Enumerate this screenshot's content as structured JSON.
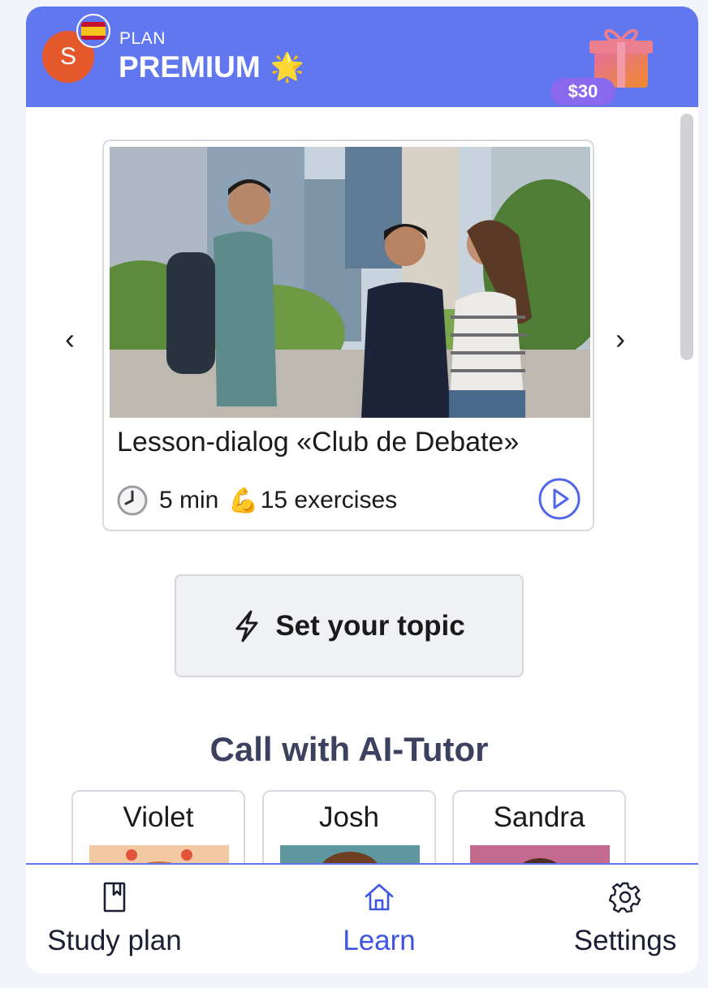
{
  "header": {
    "avatar_letter": "S",
    "plan_label": "PLAN",
    "plan_name": "PREMIUM",
    "gift_price": "$30",
    "accent_color": "#6177ef"
  },
  "lesson": {
    "title": "Lesson-dialog «Club de Debate»",
    "duration": "5 min",
    "muscle_emoji": "💪",
    "exercises": "15 exercises"
  },
  "topic_button": {
    "label": "Set your topic"
  },
  "tutors": {
    "section_title": "Call with AI-Tutor",
    "items": [
      {
        "name": "Violet"
      },
      {
        "name": "Josh"
      },
      {
        "name": "Sandra"
      }
    ]
  },
  "nav": {
    "items": [
      {
        "label": "Study plan",
        "icon": "bookmark-book-icon",
        "active": false
      },
      {
        "label": "Learn",
        "icon": "home-icon",
        "active": true
      },
      {
        "label": "Settings",
        "icon": "gear-icon",
        "active": false
      }
    ],
    "active_color": "#3d55e0"
  }
}
